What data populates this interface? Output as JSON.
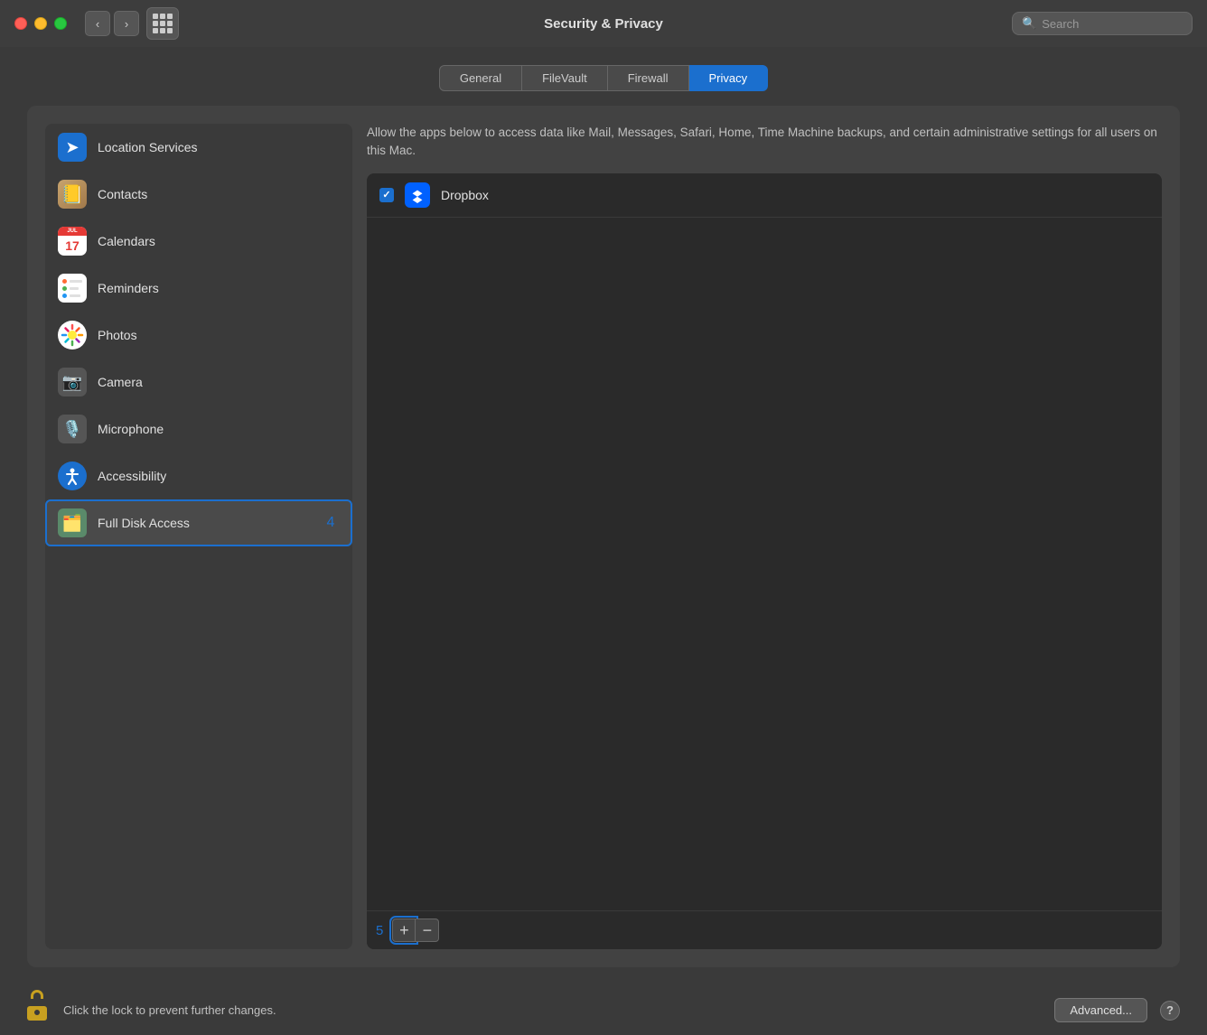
{
  "window": {
    "title": "Security & Privacy"
  },
  "titlebar": {
    "back_label": "‹",
    "forward_label": "›",
    "search_placeholder": "Search"
  },
  "tabs": [
    {
      "id": "general",
      "label": "General",
      "active": false
    },
    {
      "id": "filevault",
      "label": "FileVault",
      "active": false
    },
    {
      "id": "firewall",
      "label": "Firewall",
      "active": false
    },
    {
      "id": "privacy",
      "label": "Privacy",
      "active": true
    }
  ],
  "sidebar": {
    "items": [
      {
        "id": "location-services",
        "label": "Location Services",
        "icon": "location",
        "badge": null
      },
      {
        "id": "contacts",
        "label": "Contacts",
        "icon": "contacts",
        "badge": null
      },
      {
        "id": "calendars",
        "label": "Calendars",
        "icon": "calendars",
        "badge": null
      },
      {
        "id": "reminders",
        "label": "Reminders",
        "icon": "reminders",
        "badge": null
      },
      {
        "id": "photos",
        "label": "Photos",
        "icon": "photos",
        "badge": null
      },
      {
        "id": "camera",
        "label": "Camera",
        "icon": "camera",
        "badge": null
      },
      {
        "id": "microphone",
        "label": "Microphone",
        "icon": "microphone",
        "badge": null
      },
      {
        "id": "accessibility",
        "label": "Accessibility",
        "icon": "accessibility",
        "badge": null
      },
      {
        "id": "full-disk-access",
        "label": "Full Disk Access",
        "icon": "fulldisk",
        "badge": "4",
        "selected": true
      }
    ]
  },
  "main": {
    "description": "Allow the apps below to access data like Mail, Messages, Safari, Home, Time Machine backups, and certain administrative settings for all users on this Mac.",
    "apps": [
      {
        "id": "dropbox",
        "name": "Dropbox",
        "checked": true
      }
    ],
    "list_count": "5",
    "add_label": "+",
    "remove_label": "−"
  },
  "footer": {
    "lock_text": "Click the lock to prevent further changes.",
    "advanced_label": "Advanced...",
    "help_label": "?"
  },
  "calendar": {
    "month": "JUL",
    "day": "17"
  }
}
